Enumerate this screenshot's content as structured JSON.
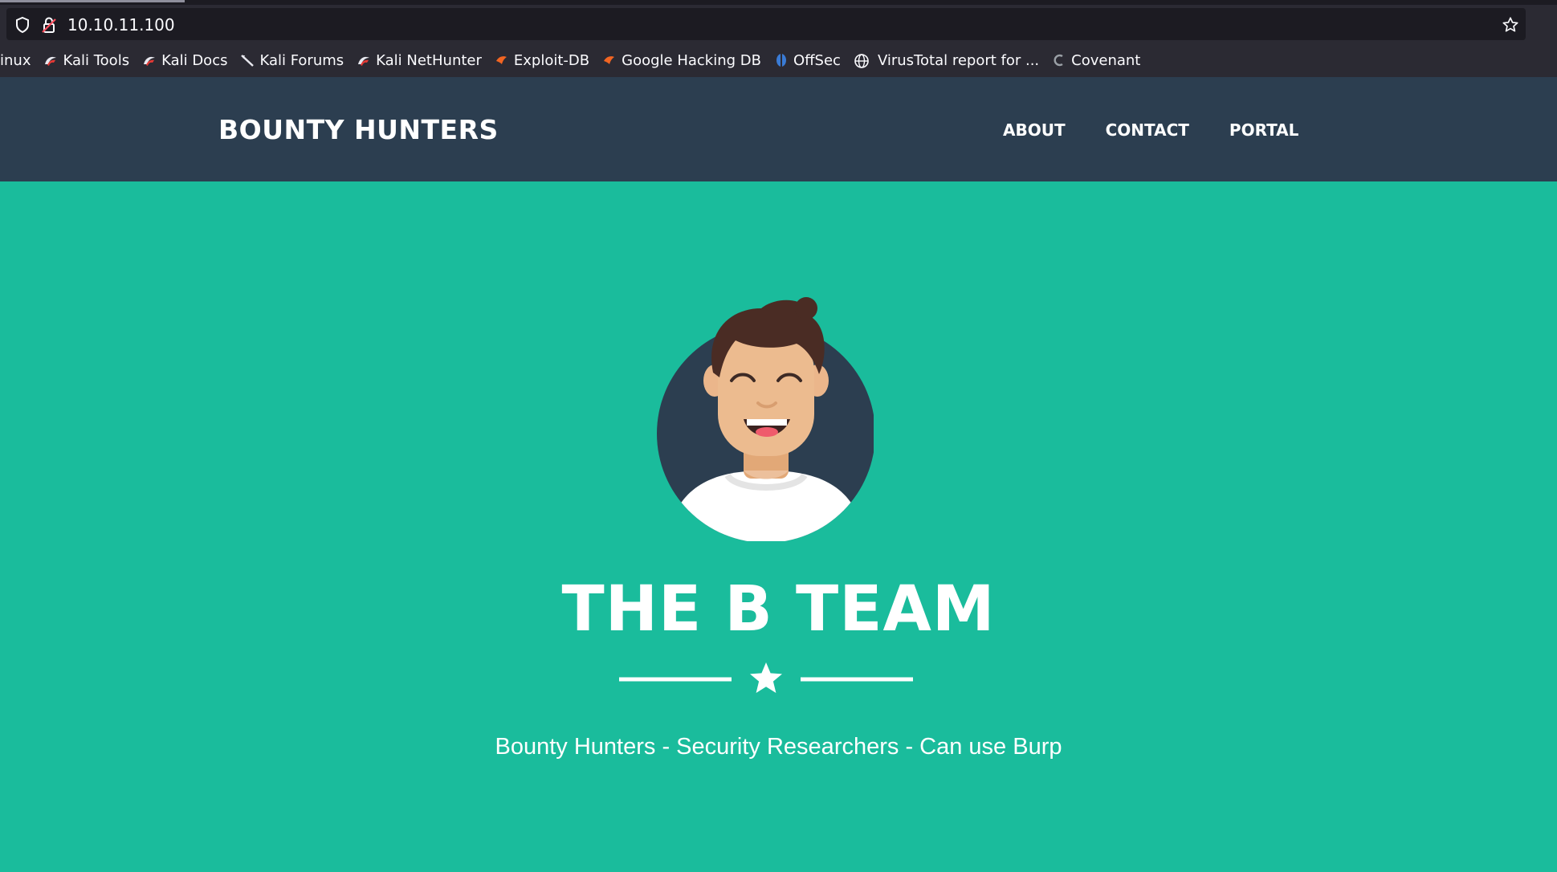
{
  "browser": {
    "url": "10.10.11.100",
    "bookmarks": [
      {
        "label": "inux",
        "icon": "none"
      },
      {
        "label": "Kali Tools",
        "icon": "kali-dragon-icon"
      },
      {
        "label": "Kali Docs",
        "icon": "kali-dragon-icon"
      },
      {
        "label": "Kali Forums",
        "icon": "kali-forums-icon"
      },
      {
        "label": "Kali NetHunter",
        "icon": "kali-dragon-icon"
      },
      {
        "label": "Exploit-DB",
        "icon": "exploit-db-icon"
      },
      {
        "label": "Google Hacking DB",
        "icon": "exploit-db-icon"
      },
      {
        "label": "OffSec",
        "icon": "offsec-icon"
      },
      {
        "label": "VirusTotal report for ...",
        "icon": "globe-icon"
      },
      {
        "label": "Covenant",
        "icon": "covenant-icon"
      }
    ]
  },
  "site": {
    "brand": "BOUNTY HUNTERS",
    "nav": [
      {
        "label": "ABOUT"
      },
      {
        "label": "CONTACT"
      },
      {
        "label": "PORTAL"
      }
    ],
    "hero": {
      "title": "THE B TEAM",
      "subtitle": "Bounty Hunters - Security Researchers - Can use Burp"
    }
  },
  "colors": {
    "navbar": "#2c3e50",
    "accent": "#1abc9c",
    "text": "#ffffff"
  }
}
